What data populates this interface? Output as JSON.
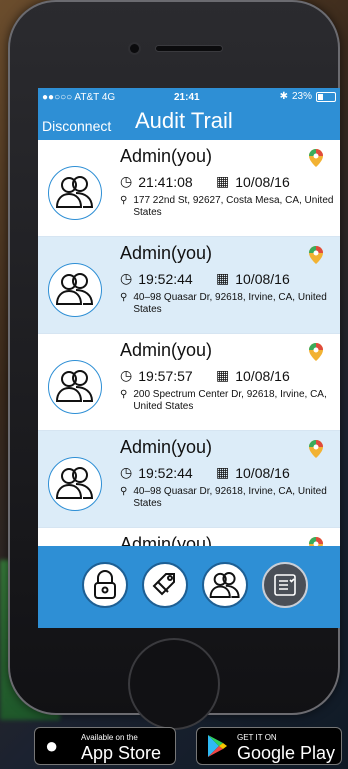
{
  "status_bar": {
    "carrier": "●●○○○ AT&T  4G",
    "time": "21:41",
    "battery": "23%"
  },
  "header": {
    "disconnect": "Disconnect",
    "title": "Audit Trail"
  },
  "entries": [
    {
      "name": "Admin(you)",
      "time": "21:41:08",
      "date": "10/08/16",
      "address": "177 22nd St, 92627, Costa Mesa, CA, United States"
    },
    {
      "name": "Admin(you)",
      "time": "19:52:44",
      "date": "10/08/16",
      "address": "40–98 Quasar Dr, 92618, Irvine, CA, United States"
    },
    {
      "name": "Admin(you)",
      "time": "19:57:57",
      "date": "10/08/16",
      "address": "200 Spectrum Center Dr, 92618, Irvine, CA, United States"
    },
    {
      "name": "Admin(you)",
      "time": "19:52:44",
      "date": "10/08/16",
      "address": "40–98 Quasar Dr, 92618, Irvine, CA, United States"
    },
    {
      "name": "Admin(you)"
    }
  ],
  "tabbar": {
    "items": [
      "lock-icon",
      "tag-icon",
      "users-icon",
      "checklist-icon"
    ]
  },
  "badges": {
    "appstore": {
      "small": "Available on the",
      "big": "App Store"
    },
    "googleplay": {
      "small": "GET IT ON",
      "big": "Google Play"
    }
  },
  "colors": {
    "primary": "#2e8fd5",
    "row_alt": "#dcecf8"
  }
}
